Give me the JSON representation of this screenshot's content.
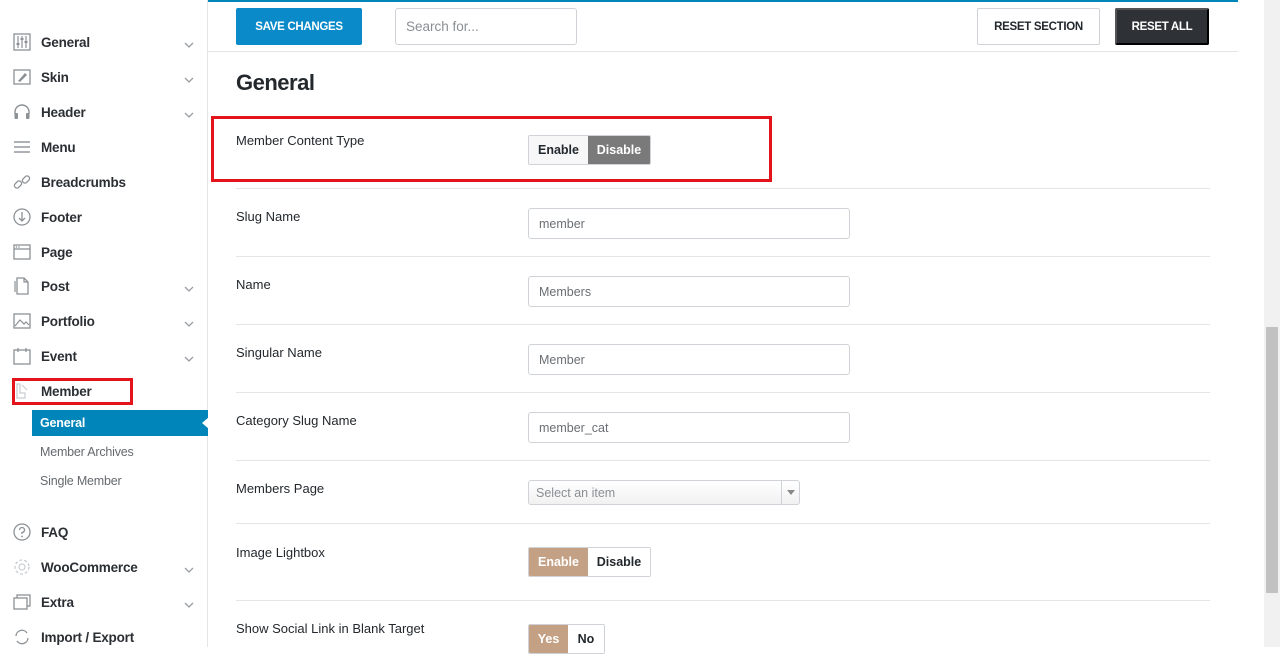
{
  "sidebar": {
    "items": [
      {
        "label": "General",
        "icon": "sliders-icon",
        "chevron": true
      },
      {
        "label": "Skin",
        "icon": "skin-icon",
        "chevron": true
      },
      {
        "label": "Header",
        "icon": "headphones-icon",
        "chevron": true
      },
      {
        "label": "Menu",
        "icon": "hamburger-icon",
        "chevron": false
      },
      {
        "label": "Breadcrumbs",
        "icon": "link-icon",
        "chevron": false
      },
      {
        "label": "Footer",
        "icon": "arrow-circle-down-icon",
        "chevron": false
      },
      {
        "label": "Page",
        "icon": "browser-icon",
        "chevron": false
      },
      {
        "label": "Post",
        "icon": "document-icon",
        "chevron": true
      },
      {
        "label": "Portfolio",
        "icon": "image-icon",
        "chevron": true
      },
      {
        "label": "Event",
        "icon": "calendar-icon",
        "chevron": true
      },
      {
        "label": "Member",
        "icon": "member-icon",
        "chevron": false
      }
    ],
    "member_sub": [
      {
        "label": "General",
        "active": true
      },
      {
        "label": "Member Archives",
        "active": false
      },
      {
        "label": "Single Member",
        "active": false
      }
    ],
    "items_after": [
      {
        "label": "FAQ",
        "icon": "question-circle-icon",
        "chevron": false
      },
      {
        "label": "WooCommerce",
        "icon": "woocommerce-icon",
        "chevron": true
      },
      {
        "label": "Extra",
        "icon": "stack-icon",
        "chevron": true
      },
      {
        "label": "Import / Export",
        "icon": "refresh-icon",
        "chevron": false
      }
    ]
  },
  "toolbar": {
    "save_label": "SAVE CHANGES",
    "search_placeholder": "Search for...",
    "reset_section_label": "RESET SECTION",
    "reset_all_label": "RESET ALL"
  },
  "main": {
    "title": "General",
    "member_content_type": {
      "label": "Member Content Type",
      "enable": "Enable",
      "disable": "Disable",
      "selected": "Disable"
    },
    "slug_name": {
      "label": "Slug Name",
      "value": "member"
    },
    "name": {
      "label": "Name",
      "value": "Members"
    },
    "singular_name": {
      "label": "Singular Name",
      "value": "Member"
    },
    "category_slug": {
      "label": "Category Slug Name",
      "value": "member_cat"
    },
    "members_page": {
      "label": "Members Page",
      "placeholder": "Select an item"
    },
    "image_lightbox": {
      "label": "Image Lightbox",
      "enable": "Enable",
      "disable": "Disable",
      "selected": "Enable"
    },
    "social_blank": {
      "label": "Show Social Link in Blank Target",
      "yes": "Yes",
      "no": "No",
      "selected": "Yes"
    }
  },
  "colors": {
    "accent": "#0085ba",
    "highlight": "#e3131c",
    "toggle_selected_dark": "#7a7a7a",
    "toggle_selected_tan": "#c4a184"
  }
}
